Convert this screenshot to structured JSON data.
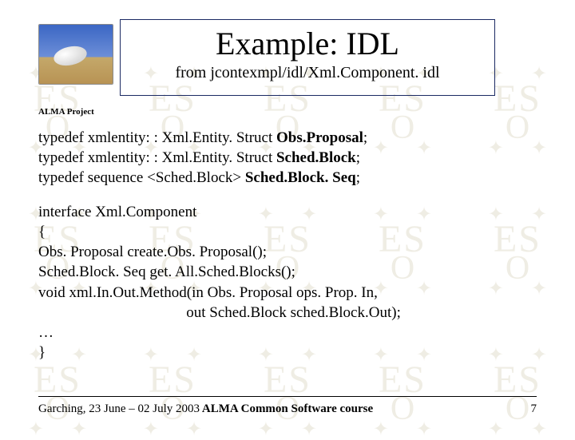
{
  "title": "Example: IDL",
  "subtitle": "from jcontexmpl/idl/Xml.Component. idl",
  "project_label": "ALMA Project",
  "typedefs": {
    "l1_a": "typedef xmlentity: : Xml.Entity. Struct ",
    "l1_b": "Obs.Proposal",
    "l1_c": ";",
    "l2_a": "typedef xmlentity: : Xml.Entity. Struct ",
    "l2_b": "Sched.Block",
    "l2_c": ";",
    "l3_a": "typedef sequence <Sched.Block> ",
    "l3_b": "Sched.Block. Seq",
    "l3_c": ";"
  },
  "iface": {
    "l1": "interface Xml.Component",
    "l2": "{",
    "l3": "Obs. Proposal create.Obs. Proposal();",
    "l4": "Sched.Block. Seq get. All.Sched.Blocks();",
    "l5": "void xml.In.Out.Method(in Obs. Proposal ops. Prop. In,",
    "l6": "                                       out Sched.Block sched.Block.Out);",
    "l7": "…",
    "l8": "}"
  },
  "footer": {
    "left": "Garching, 23 June – 02 July 2003",
    "center": "ALMA Common Software course",
    "right": "7"
  },
  "watermark": {
    "es": "ES",
    "o": "O",
    "star": "✦"
  }
}
